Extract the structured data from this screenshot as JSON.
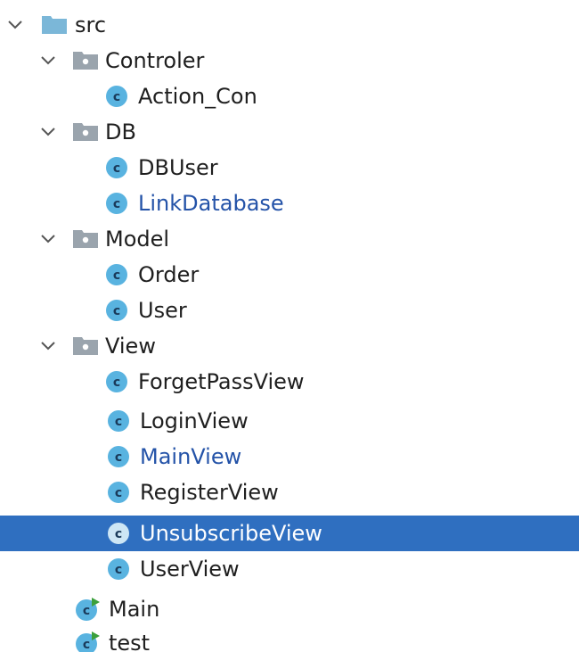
{
  "tree": {
    "items": [
      {
        "label": "src",
        "kind": "folder",
        "folder_color": "#7bb7d8",
        "expanded": true
      },
      {
        "label": "Controler",
        "kind": "folder",
        "folder_color": "#9aa4ad",
        "expanded": true
      },
      {
        "label": "Action_Con",
        "kind": "class"
      },
      {
        "label": "DB",
        "kind": "folder",
        "folder_color": "#9aa4ad",
        "expanded": true
      },
      {
        "label": "DBUser",
        "kind": "class"
      },
      {
        "label": "LinkDatabase",
        "kind": "class",
        "highlighted": true
      },
      {
        "label": "Model",
        "kind": "folder",
        "folder_color": "#9aa4ad",
        "expanded": true
      },
      {
        "label": "Order",
        "kind": "class"
      },
      {
        "label": "User",
        "kind": "class"
      },
      {
        "label": "View",
        "kind": "folder",
        "folder_color": "#9aa4ad",
        "expanded": true
      },
      {
        "label": "ForgetPassView",
        "kind": "class"
      },
      {
        "label": "LoginView",
        "kind": "class"
      },
      {
        "label": "MainView",
        "kind": "class",
        "highlighted": true
      },
      {
        "label": "RegisterView",
        "kind": "class"
      },
      {
        "label": "UnsubscribeView",
        "kind": "class",
        "selected": true
      },
      {
        "label": "UserView",
        "kind": "class"
      },
      {
        "label": "Main",
        "kind": "runnable-class"
      },
      {
        "label": "test",
        "kind": "runnable-class"
      }
    ]
  },
  "colors": {
    "selection_bg": "#2f6fc0",
    "highlight_text": "#2453a8",
    "class_icon": "#59b3e0",
    "run_badge": "#3ca03c"
  }
}
